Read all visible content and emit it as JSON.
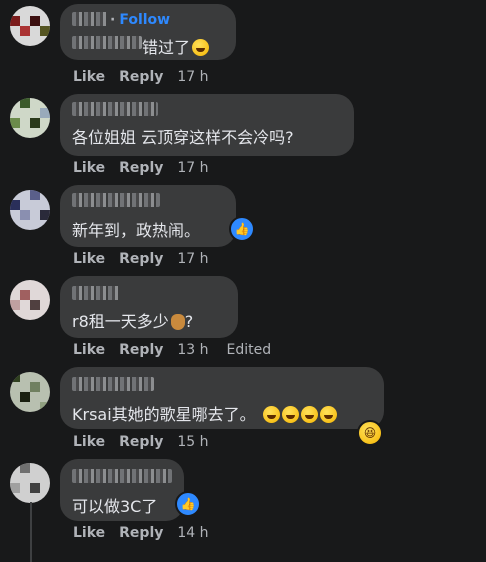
{
  "actions": {
    "like": "Like",
    "reply": "Reply"
  },
  "comments": [
    {
      "follow": "Follow",
      "text": "错过了",
      "emoji": "rofl",
      "time": "17 h",
      "edited": ""
    },
    {
      "text": "各位姐姐 云顶穿这样不会冷吗?",
      "time": "17 h",
      "edited": ""
    },
    {
      "text": "新年到，政热闹。",
      "reaction": "like",
      "time": "17 h",
      "edited": ""
    },
    {
      "text": "r8租一天多少",
      "text_suffix": "?",
      "emoji": "money-bag",
      "time": "13 h",
      "edited": "Edited"
    },
    {
      "text": "Krsai其她的歌星哪去了。",
      "emoji": "laughing-x4",
      "reaction": "laugh",
      "time": "15 h",
      "edited": ""
    },
    {
      "text": "可以做3C了",
      "reaction": "like",
      "time": "14 h",
      "edited": ""
    }
  ],
  "colors": {
    "background": "#18191a",
    "bubble": "#3a3b3c",
    "link": "#2e89ff",
    "muted": "#b0b3b8"
  }
}
